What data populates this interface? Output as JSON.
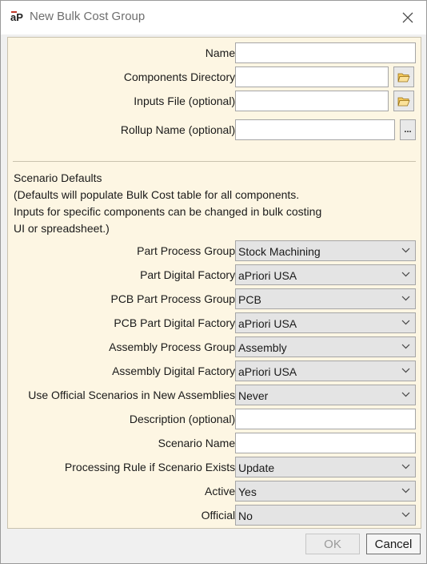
{
  "window": {
    "title": "New Bulk Cost Group",
    "app_icon_text": "aP"
  },
  "fields": {
    "name_label": "Name:",
    "components_directory_label": "Components Directory:",
    "inputs_file_label": "Inputs File (optional):",
    "rollup_name_label": "Rollup Name (optional):",
    "browse_label": "..."
  },
  "scenario": {
    "heading": "Scenario Defaults",
    "note_line1": "(Defaults will populate Bulk Cost table for all components.",
    "note_line2": "Inputs for specific components can be changed in bulk costing",
    "note_line3": "UI or spreadsheet.)",
    "part_process_group_label": "Part Process Group:",
    "part_process_group_value": "Stock Machining",
    "part_digital_factory_label": "Part Digital Factory:",
    "part_digital_factory_value": "aPriori USA",
    "pcb_part_process_group_label": "PCB Part Process Group:",
    "pcb_part_process_group_value": "PCB",
    "pcb_part_digital_factory_label": "PCB Part Digital Factory:",
    "pcb_part_digital_factory_value": "aPriori USA",
    "assembly_process_group_label": "Assembly Process Group:",
    "assembly_process_group_value": "Assembly",
    "assembly_digital_factory_label": "Assembly Digital Factory:",
    "assembly_digital_factory_value": "aPriori USA",
    "use_official_label": "Use Official Scenarios in New Assemblies:",
    "use_official_value": "Never",
    "description_label": "Description (optional):",
    "scenario_name_label": "Scenario Name:",
    "processing_rule_label": "Processing Rule if Scenario Exists:",
    "processing_rule_value": "Update",
    "active_label": "Active:",
    "active_value": "Yes",
    "official_label": "Official:",
    "official_value": "No"
  },
  "buttons": {
    "ok": "OK",
    "cancel": "Cancel"
  }
}
